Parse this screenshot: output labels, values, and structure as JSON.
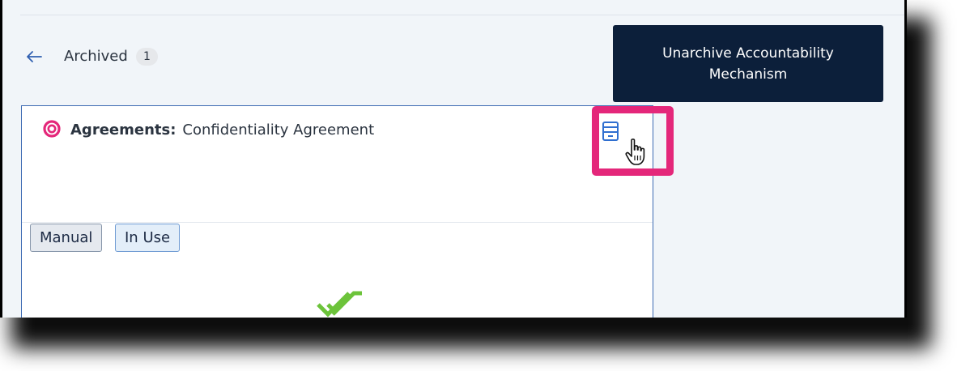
{
  "header": {
    "section_title": "Archived",
    "count": "1",
    "back_icon": "arrow-left-icon",
    "unarchive_button_label": "Unarchive Accountability Mechanism"
  },
  "card": {
    "icon": "target-icon",
    "label": "Agreements:",
    "title": "Confidentiality Agreement",
    "tags": [
      "Manual",
      "In Use"
    ],
    "action_icon": "document-icon",
    "status_icon": "double-check-icon"
  },
  "overlay": {
    "cursor_icon": "hand-pointer-icon",
    "highlight_color": "#e4277a"
  },
  "colors": {
    "primary_dark": "#0c1f3a",
    "accent_blue": "#3d6bb3",
    "brand_pink": "#e4277a",
    "success_green": "#6cc33a"
  }
}
